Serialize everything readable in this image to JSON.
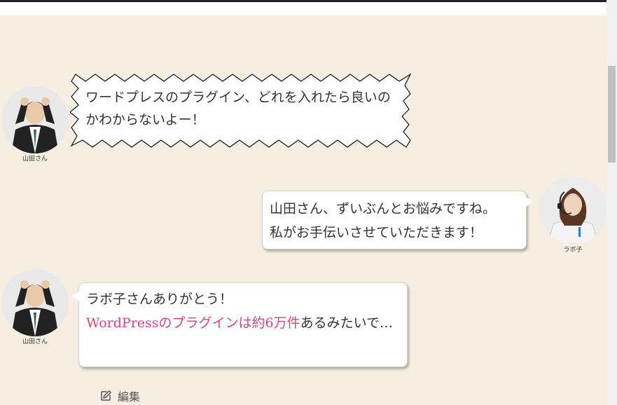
{
  "speakers": {
    "yamada": "山田さん",
    "labo": "ラボ子"
  },
  "messages": [
    {
      "text": "ワードプレスのプラグイン、どれを入れたら良いのかわからないよー！"
    },
    {
      "text_line1": "山田さん、ずいぶんとお悩みですね。",
      "text_line2": "私がお手伝いさせていただきます！"
    },
    {
      "text_line1": "ラボ子さんありがとう！",
      "highlight": "WordPressのプラグインは約6万件",
      "text_rest": "あるみたいで…"
    }
  ],
  "edit": {
    "icon": "edit-icon",
    "label": "編集"
  },
  "colors": {
    "background": "#f5eee1",
    "highlight": "#d9437f",
    "bubble": "#ffffff"
  }
}
